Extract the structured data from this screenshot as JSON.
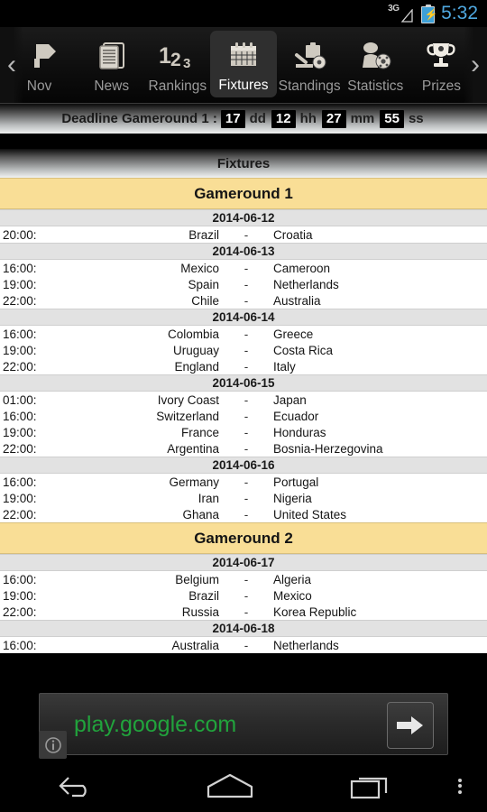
{
  "statusbar": {
    "network": "3G",
    "network_icon": "signal-3g-icon",
    "battery_icon": "battery-charging-icon",
    "time": "5:32"
  },
  "tabbar": {
    "scroll_left_icon": "chevron-left-icon",
    "scroll_right_icon": "chevron-right-icon",
    "tabs": [
      {
        "label": "Nov",
        "icon": "overview-icon",
        "selected": false,
        "clipped": true
      },
      {
        "label": "News",
        "icon": "newspaper-icon",
        "selected": false
      },
      {
        "label": "Rankings",
        "icon": "numbers-123-icon",
        "selected": false
      },
      {
        "label": "Fixtures",
        "icon": "calendar-icon",
        "selected": true
      },
      {
        "label": "Standings",
        "icon": "clipboard-ball-icon",
        "selected": false
      },
      {
        "label": "Statistics",
        "icon": "player-ball-icon",
        "selected": false
      },
      {
        "label": "Prizes",
        "icon": "trophy-icon",
        "selected": false
      }
    ]
  },
  "deadline": {
    "label": "Deadline Gameround 1 :",
    "days": "17",
    "days_unit": "dd",
    "hours": "12",
    "hours_unit": "hh",
    "minutes": "27",
    "minutes_unit": "mm",
    "seconds": "55",
    "seconds_unit": "ss"
  },
  "page": {
    "title": "Fixtures"
  },
  "fixtures": [
    {
      "gameround": "Gameround 1",
      "days": [
        {
          "date": "2014-06-12",
          "matches": [
            {
              "time": "20:00:",
              "home": "Brazil",
              "sep": "-",
              "away": "Croatia"
            }
          ]
        },
        {
          "date": "2014-06-13",
          "matches": [
            {
              "time": "16:00:",
              "home": "Mexico",
              "sep": "-",
              "away": "Cameroon"
            },
            {
              "time": "19:00:",
              "home": "Spain",
              "sep": "-",
              "away": "Netherlands"
            },
            {
              "time": "22:00:",
              "home": "Chile",
              "sep": "-",
              "away": "Australia"
            }
          ]
        },
        {
          "date": "2014-06-14",
          "matches": [
            {
              "time": "16:00:",
              "home": "Colombia",
              "sep": "-",
              "away": "Greece"
            },
            {
              "time": "19:00:",
              "home": "Uruguay",
              "sep": "-",
              "away": "Costa Rica"
            },
            {
              "time": "22:00:",
              "home": "England",
              "sep": "-",
              "away": "Italy"
            }
          ]
        },
        {
          "date": "2014-06-15",
          "matches": [
            {
              "time": "01:00:",
              "home": "Ivory Coast",
              "sep": "-",
              "away": "Japan"
            },
            {
              "time": "16:00:",
              "home": "Switzerland",
              "sep": "-",
              "away": "Ecuador"
            },
            {
              "time": "19:00:",
              "home": "France",
              "sep": "-",
              "away": "Honduras"
            },
            {
              "time": "22:00:",
              "home": "Argentina",
              "sep": "-",
              "away": "Bosnia-Herzegovina"
            }
          ]
        },
        {
          "date": "2014-06-16",
          "matches": [
            {
              "time": "16:00:",
              "home": "Germany",
              "sep": "-",
              "away": "Portugal"
            },
            {
              "time": "19:00:",
              "home": "Iran",
              "sep": "-",
              "away": "Nigeria"
            },
            {
              "time": "22:00:",
              "home": "Ghana",
              "sep": "-",
              "away": "United States"
            }
          ]
        }
      ]
    },
    {
      "gameround": "Gameround 2",
      "days": [
        {
          "date": "2014-06-17",
          "matches": [
            {
              "time": "16:00:",
              "home": "Belgium",
              "sep": "-",
              "away": "Algeria"
            },
            {
              "time": "19:00:",
              "home": "Brazil",
              "sep": "-",
              "away": "Mexico"
            },
            {
              "time": "22:00:",
              "home": "Russia",
              "sep": "-",
              "away": "Korea Republic"
            }
          ]
        },
        {
          "date": "2014-06-18",
          "matches": [
            {
              "time": "16:00:",
              "home": "Australia",
              "sep": "-",
              "away": "Netherlands"
            }
          ]
        }
      ]
    }
  ],
  "ad": {
    "url": "play.google.com",
    "url_color": "#21a33c",
    "info_icon": "info-icon",
    "go_icon": "arrow-right-icon"
  },
  "navbar": {
    "back_icon": "back-arrow-icon",
    "home_icon": "home-icon",
    "recents_icon": "recent-apps-icon",
    "more_icon": "overflow-menu-icon"
  }
}
